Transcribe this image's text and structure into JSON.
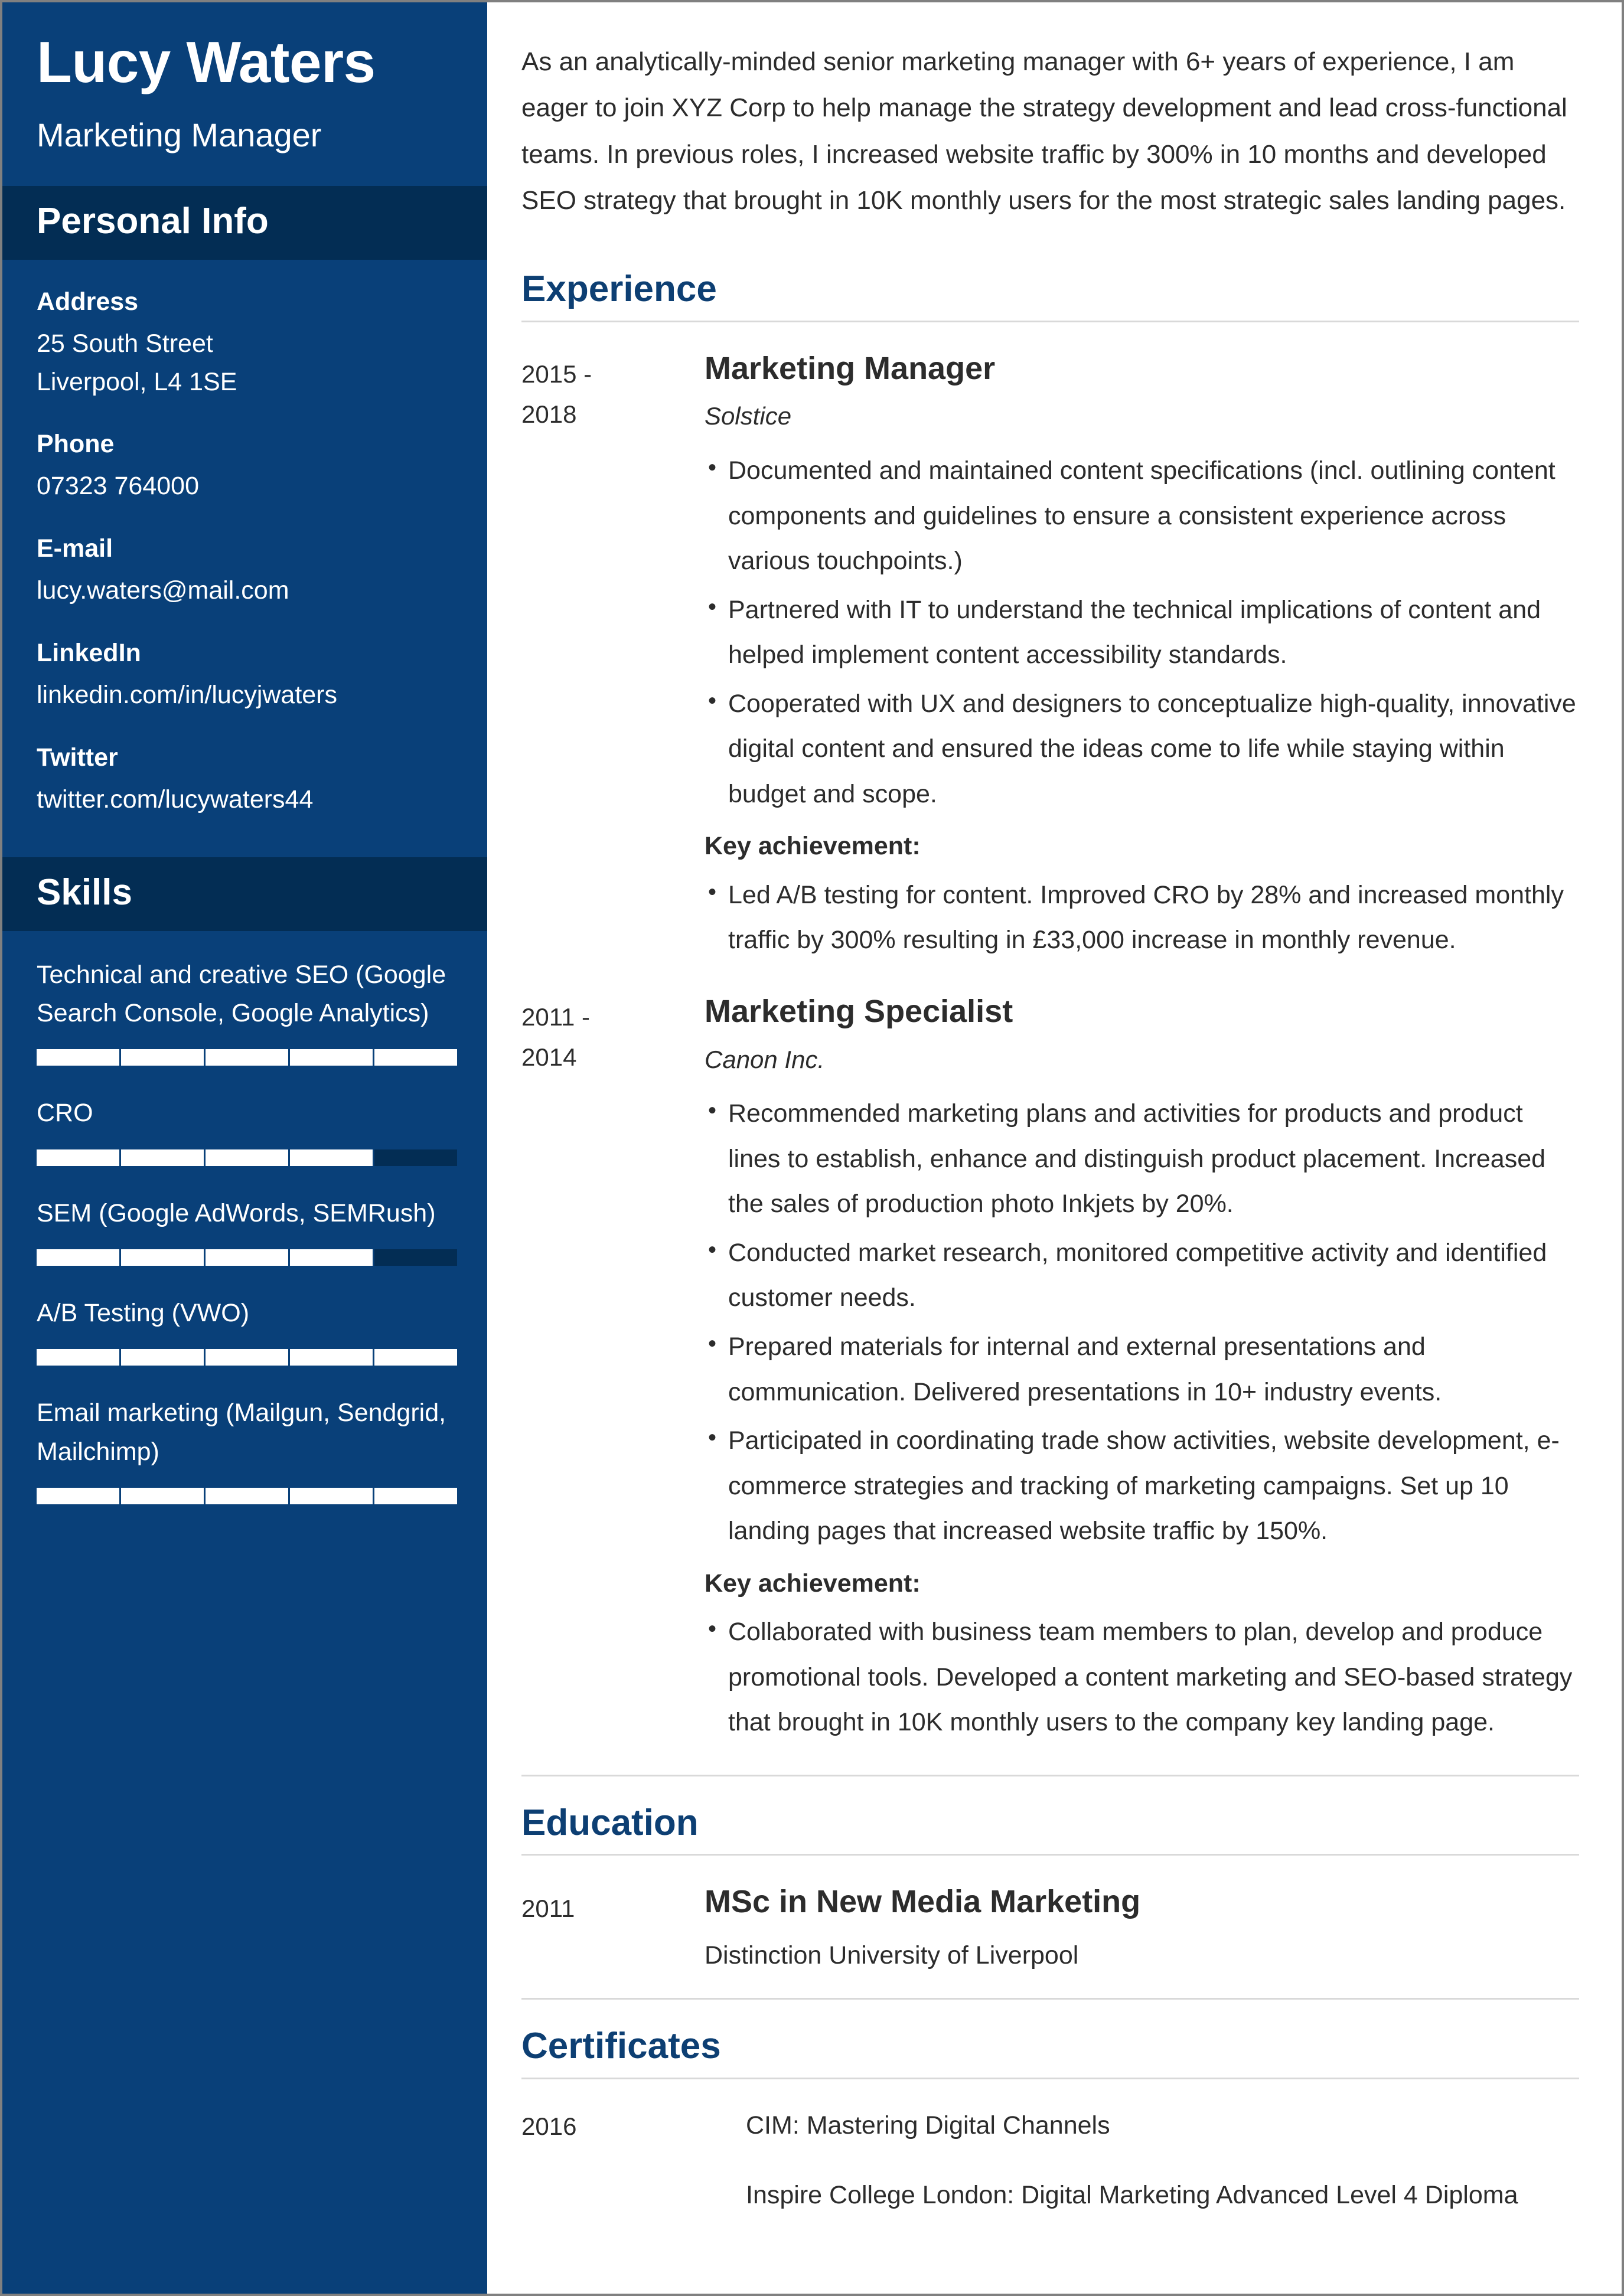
{
  "colors": {
    "sidebar_bg": "#094079",
    "sidebar_header_bg": "#032d54",
    "accent_heading": "#0d3f73",
    "body_text": "#2c2c2c",
    "rule": "#d9d9d9",
    "skill_filled": "#ffffff",
    "skill_empty": "#032d54"
  },
  "sidebar": {
    "full_name": "Lucy Waters",
    "job_title": "Marketing Manager",
    "personal_info": {
      "heading": "Personal Info",
      "fields": [
        {
          "label": "Address",
          "value_lines": [
            "25 South Street",
            "Liverpool, L4 1SE"
          ]
        },
        {
          "label": "Phone",
          "value_lines": [
            "07323 764000"
          ]
        },
        {
          "label": "E-mail",
          "value_lines": [
            "lucy.waters@mail.com"
          ]
        },
        {
          "label": "LinkedIn",
          "value_lines": [
            "linkedin.com/in/lucyjwaters"
          ]
        },
        {
          "label": "Twitter",
          "value_lines": [
            "twitter.com/lucywaters44"
          ]
        }
      ]
    },
    "skills": {
      "heading": "Skills",
      "max_level": 5,
      "items": [
        {
          "name": "Technical and creative SEO (Google Search Console, Google Analytics)",
          "level": 5
        },
        {
          "name": "CRO",
          "level": 4
        },
        {
          "name": "SEM (Google AdWords, SEMRush)",
          "level": 4
        },
        {
          "name": "A/B Testing (VWO)",
          "level": 5
        },
        {
          "name": "Email marketing (Mailgun, Sendgrid, Mailchimp)",
          "level": 5
        }
      ]
    }
  },
  "main": {
    "summary": "As an analytically-minded senior marketing manager with 6+ years of experience, I am eager to join XYZ Corp to help manage the strategy development and lead cross-functional teams. In previous roles, I increased website traffic by 300% in 10 months and developed SEO strategy that brought in 10K monthly users for the most strategic sales landing pages.",
    "experience": {
      "heading": "Experience",
      "entries": [
        {
          "date_start": "2015 -",
          "date_end": "2018",
          "role": "Marketing Manager",
          "company": "Solstice",
          "bullets": [
            "Documented and maintained content specifications (incl. outlining content components and guidelines to ensure a consistent experience across various touchpoints.)",
            "Partnered with IT to understand the technical implications of content and helped implement content accessibility standards.",
            "Cooperated with UX and designers to conceptualize high-quality, innovative digital content and ensured the ideas come to life while staying within budget and scope."
          ],
          "achievement_label": "Key achievement:",
          "achievements": [
            "Led A/B testing for content. Improved CRO by 28% and increased monthly traffic by 300% resulting in £33,000 increase in monthly revenue."
          ]
        },
        {
          "date_start": "2011 -",
          "date_end": "2014",
          "role": "Marketing Specialist",
          "company": "Canon Inc.",
          "bullets": [
            "Recommended marketing plans and activities for products and product lines to establish, enhance and distinguish product placement. Increased the sales of production photo Inkjets by 20%.",
            "Conducted market research, monitored competitive activity and identified customer needs.",
            "Prepared materials for internal and external presentations and communication. Delivered presentations in 10+ industry events.",
            "Participated in coordinating trade show activities, website development, e-commerce strategies and tracking of marketing campaigns. Set up 10 landing pages that increased website traffic by 150%."
          ],
          "achievement_label": "Key achievement:",
          "achievements": [
            "Collaborated with business team members to plan, develop and produce promotional tools. Developed a content marketing and SEO-based strategy that brought in 10K monthly users to the company key landing page."
          ]
        }
      ]
    },
    "education": {
      "heading": "Education",
      "entries": [
        {
          "date": "2011",
          "degree": "MSc in New Media Marketing",
          "school": "Distinction University of Liverpool"
        }
      ]
    },
    "certificates": {
      "heading": "Certificates",
      "entries": [
        {
          "date": "2016",
          "lines": [
            "CIM: Mastering Digital Channels",
            "Inspire College London: Digital Marketing Advanced Level 4 Diploma"
          ]
        }
      ]
    }
  }
}
